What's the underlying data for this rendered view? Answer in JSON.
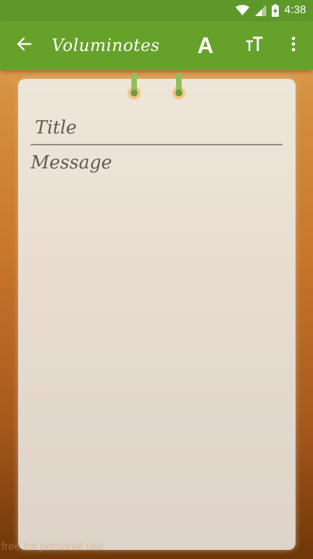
{
  "status_bar": {
    "time": "4:38",
    "icons": [
      "wifi-icon",
      "cellular-signal-icon",
      "battery-charging-icon"
    ]
  },
  "app_bar": {
    "title": "Voluminotes",
    "back_icon": "arrow-left-icon",
    "font_button_label": "A",
    "text_size_icon": "text-size-icon",
    "more_icon": "more-vertical-icon"
  },
  "note": {
    "title_placeholder": "Title",
    "message_placeholder": "Message"
  },
  "watermark": "free for personal use",
  "colors": {
    "status_bar": "#5f982a",
    "app_bar": "#66a22a",
    "ring": "#8fc05a",
    "paper": "#ede4d8",
    "text": "#615a55"
  }
}
